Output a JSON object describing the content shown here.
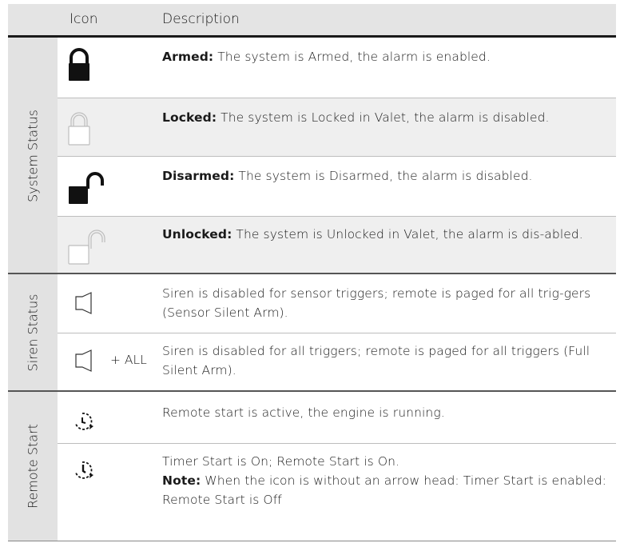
{
  "header": {
    "icon_col": "Icon",
    "desc_col": "Description"
  },
  "sections": {
    "system": {
      "label": "System Status",
      "rows": [
        {
          "term": "Armed:",
          "text": " The system is Armed, the alarm is enabled.",
          "icon": "lock-closed-icon"
        },
        {
          "term": "Locked:",
          "text": " The system is Locked in Valet, the alarm is disabled.",
          "icon": "lock-closed-outline-icon"
        },
        {
          "term": "Disarmed:",
          "text": " The system is Disarmed, the alarm is disabled.",
          "icon": "lock-open-icon"
        },
        {
          "term": "Unlocked:",
          "text": " The system is Unlocked in Valet, the alarm is dis-abled.",
          "icon": "lock-open-outline-icon"
        }
      ]
    },
    "siren": {
      "label": "Siren Status",
      "rows": [
        {
          "text": "Siren is disabled for sensor triggers; remote is paged for all trig-gers (Sensor Silent Arm).",
          "icon": "siren-icon"
        },
        {
          "text": "Siren is disabled for all triggers; remote is paged for all triggers (Full Silent Arm).",
          "icon": "siren-icon",
          "suffix": "+ ALL"
        }
      ]
    },
    "remote": {
      "label": "Remote Start",
      "rows": [
        {
          "text": "Remote start is active, the engine is running.",
          "icon": "remote-start-icon"
        },
        {
          "text": "Timer Start is On; Remote Start is On.",
          "note_label": "Note:",
          "note_text": " When the icon is without an arrow head: Timer Start is enabled: Remote Start is Off",
          "icon": "timer-start-icon"
        }
      ]
    }
  }
}
